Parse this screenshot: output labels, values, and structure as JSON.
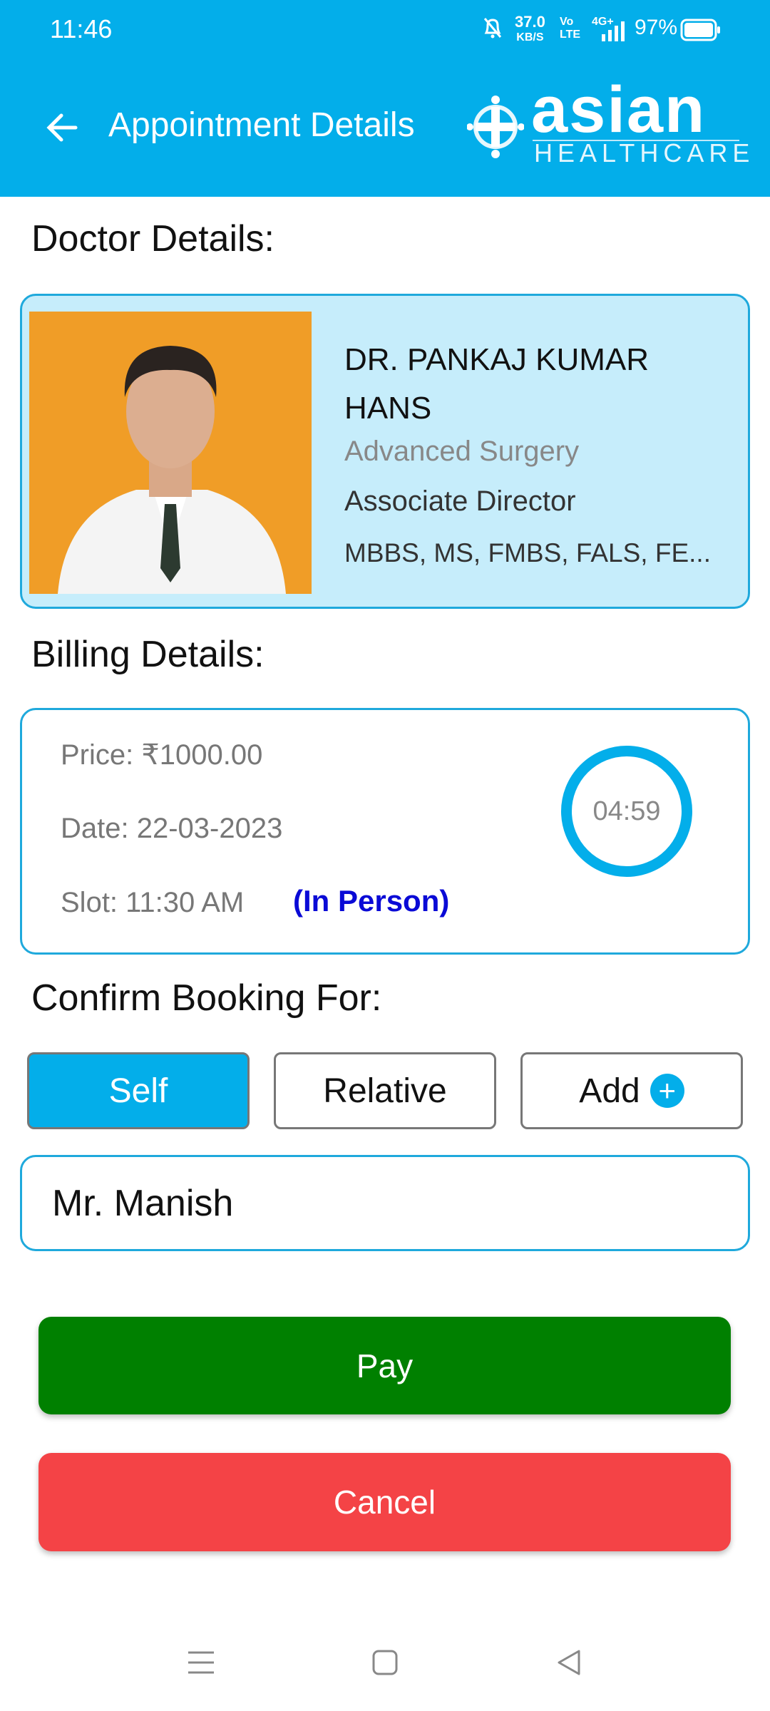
{
  "status_bar": {
    "time": "11:46",
    "net_speed": "37.0",
    "net_unit": "KB/S",
    "volte": "Vo LTE",
    "network": "4G+",
    "battery": "97%"
  },
  "header": {
    "title": "Appointment Details",
    "logo_text": "asian",
    "logo_sub": "HEALTHCARE"
  },
  "doctor": {
    "section_title": "Doctor Details:",
    "name_line1": "DR. PANKAJ KUMAR",
    "name_line2": "HANS",
    "specialty": "Advanced Surgery",
    "designation": "Associate Director",
    "degrees": "MBBS, MS, FMBS, FALS, FE..."
  },
  "billing": {
    "section_title": "Billing Details:",
    "price": "Price: ₹1000.00",
    "date": "Date: 22-03-2023",
    "slot": "Slot: 11:30 AM",
    "mode": "(In Person)",
    "timer": "04:59"
  },
  "booking": {
    "section_title": "Confirm Booking For:",
    "options": [
      {
        "label": "Self",
        "selected": true
      },
      {
        "label": "Relative",
        "selected": false
      },
      {
        "label": "Add",
        "selected": false
      }
    ],
    "patient_name": "Mr. Manish"
  },
  "actions": {
    "pay": "Pay",
    "cancel": "Cancel"
  },
  "colors": {
    "primary": "#03aeea",
    "pay": "#008000",
    "cancel": "#f44346",
    "mode": "#0a0ad6"
  }
}
